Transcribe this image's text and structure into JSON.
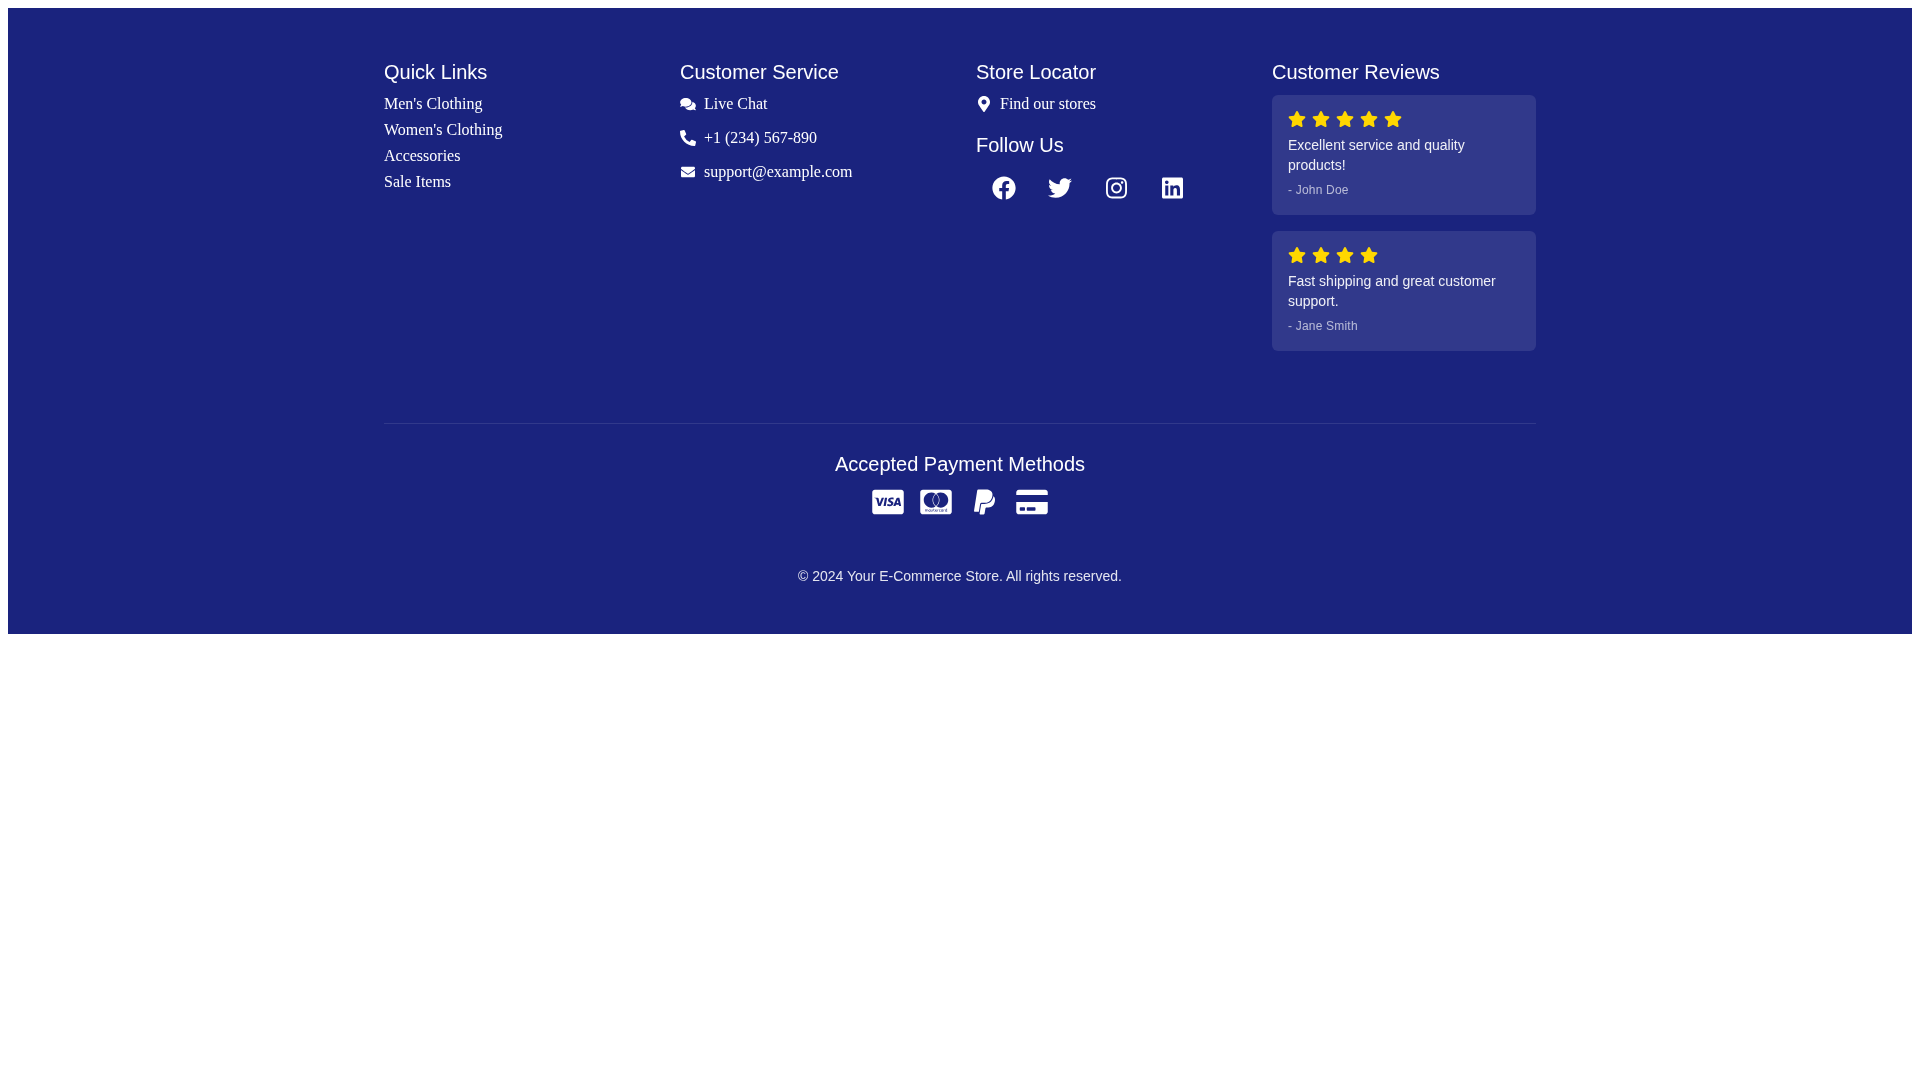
{
  "footer": {
    "quick_links": {
      "title": "Quick Links",
      "links": [
        "Men's Clothing",
        "Women's Clothing",
        "Accessories",
        "Sale Items"
      ]
    },
    "customer_service": {
      "title": "Customer Service",
      "items": [
        {
          "kind": "chat",
          "label": "Live Chat"
        },
        {
          "kind": "phone",
          "label": "+1 (234) 567-890"
        },
        {
          "kind": "email",
          "label": "support@example.com"
        }
      ]
    },
    "store_locator": {
      "title": "Store Locator",
      "link": "Find our stores"
    },
    "follow_us": {
      "title": "Follow Us",
      "networks": [
        {
          "kind": "facebook"
        },
        {
          "kind": "twitter"
        },
        {
          "kind": "instagram"
        },
        {
          "kind": "linkedin"
        }
      ]
    },
    "customer_reviews": {
      "title": "Customer Reviews",
      "reviews": [
        {
          "stars": 5,
          "text": "Excellent service and quality products!",
          "author": "- John Doe"
        },
        {
          "stars": 4,
          "text": "Fast shipping and great customer support.",
          "author": "- Jane Smith"
        }
      ]
    },
    "payment_methods": {
      "title": "Accepted Payment Methods",
      "cards": [
        {
          "kind": "visa"
        },
        {
          "kind": "mastercard"
        },
        {
          "kind": "paypal"
        },
        {
          "kind": "credit_card"
        }
      ]
    },
    "copyright": "© 2024 Your E-Commerce Store. All rights reserved."
  }
}
